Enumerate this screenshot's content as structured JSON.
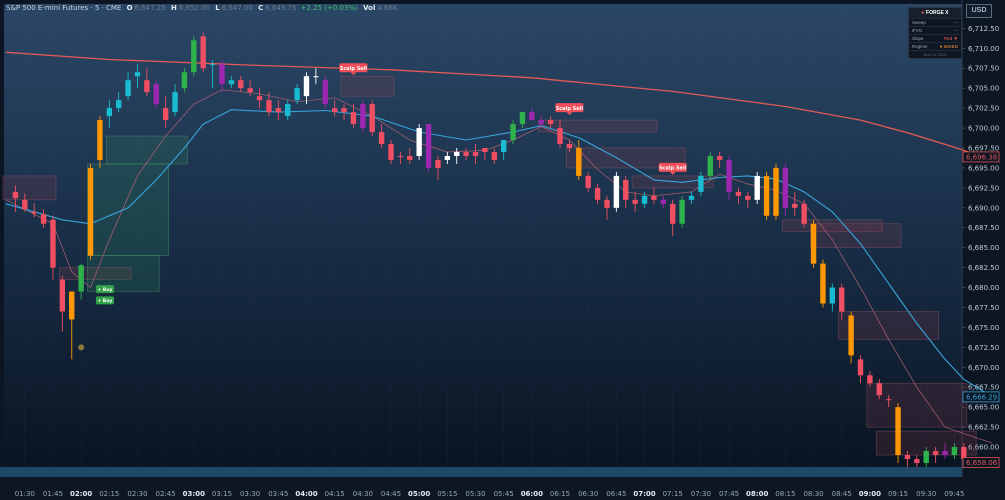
{
  "header": {
    "symbol": "S&P 500 E-mini Futures · 5 · CME",
    "o_label": "O",
    "o_value": "6,647.25",
    "h_label": "H",
    "h_value": "6,652.00",
    "l_label": "L",
    "l_value": "6,647.00",
    "c_label": "C",
    "c_value": "6,649.75",
    "change": "+2.25 (+0.03%)",
    "vol_label": "Vol",
    "vol_value": "4.66K"
  },
  "currency": "USD",
  "forge_panel": {
    "title": "FORGE X",
    "rows": [
      {
        "label": "Sweep",
        "value": "—"
      },
      {
        "label": "iFVG",
        "value": "—"
      },
      {
        "label": "Slope",
        "value": "Red ▼"
      },
      {
        "label": "Regime",
        "value": "● MIXED"
      }
    ],
    "footer": "Nov 12 2025"
  },
  "chart_data": {
    "type": "candlestick",
    "ylim": [
      6657.5,
      6713.8
    ],
    "y_ticks": [
      "6,712.50",
      "6,710.00",
      "6,707.50",
      "6,705.00",
      "6,702.50",
      "6,700.00",
      "6,697.50",
      "6,695.00",
      "6,692.50",
      "6,690.00",
      "6,687.50",
      "6,685.00",
      "6,682.50",
      "6,680.00",
      "6,677.50",
      "6,675.00",
      "6,672.50",
      "6,670.00",
      "6,667.50",
      "6,665.00",
      "6,662.50",
      "6,660.00"
    ],
    "x_ticks": [
      {
        "label": "01:30",
        "i": 1
      },
      {
        "label": "01:45",
        "i": 4
      },
      {
        "label": "02:00",
        "i": 7
      },
      {
        "label": "02:15",
        "i": 10
      },
      {
        "label": "02:30",
        "i": 13
      },
      {
        "label": "02:45",
        "i": 16
      },
      {
        "label": "03:00",
        "i": 19
      },
      {
        "label": "03:15",
        "i": 22
      },
      {
        "label": "03:30",
        "i": 25
      },
      {
        "label": "03:45",
        "i": 28
      },
      {
        "label": "04:00",
        "i": 31
      },
      {
        "label": "04:15",
        "i": 34
      },
      {
        "label": "04:30",
        "i": 37
      },
      {
        "label": "04:45",
        "i": 40
      },
      {
        "label": "05:00",
        "i": 43
      },
      {
        "label": "05:15",
        "i": 46
      },
      {
        "label": "05:30",
        "i": 49
      },
      {
        "label": "05:45",
        "i": 52
      },
      {
        "label": "06:00",
        "i": 55
      },
      {
        "label": "06:15",
        "i": 58
      },
      {
        "label": "06:30",
        "i": 61
      },
      {
        "label": "06:45",
        "i": 64
      },
      {
        "label": "07:00",
        "i": 67
      },
      {
        "label": "07:15",
        "i": 70
      },
      {
        "label": "07:30",
        "i": 73
      },
      {
        "label": "07:45",
        "i": 76
      },
      {
        "label": "08:00",
        "i": 79
      },
      {
        "label": "08:15",
        "i": 82
      },
      {
        "label": "08:30",
        "i": 85
      },
      {
        "label": "08:45",
        "i": 88
      },
      {
        "label": "09:00",
        "i": 91
      },
      {
        "label": "09:15",
        "i": 94
      },
      {
        "label": "09:30",
        "i": 97
      },
      {
        "label": "09:45",
        "i": 100
      }
    ],
    "bold_x_labels": [
      "02:00",
      "03:00",
      "04:00",
      "05:00",
      "06:00",
      "07:00",
      "08:00",
      "09:00"
    ],
    "price_labels": [
      {
        "value": "6,696.38",
        "price": 6696.38,
        "color": "#e05555"
      },
      {
        "value": "6,666.29",
        "price": 6666.29,
        "color": "#3aa0d8"
      },
      {
        "value": "6,658.06",
        "price": 6658.06,
        "color": "#e05555"
      }
    ],
    "candles": [
      [
        6692.0,
        6692.8,
        6689.5,
        6691.2,
        "r"
      ],
      [
        6691.0,
        6691.8,
        6689.5,
        6689.8,
        "r"
      ],
      [
        6689.5,
        6690.6,
        6688.8,
        6689.3,
        "r"
      ],
      [
        6689.2,
        6689.8,
        6687.5,
        6688.0,
        "r"
      ],
      [
        6688.5,
        6689.0,
        6681.0,
        6682.5,
        "r"
      ],
      [
        6681.0,
        6681.5,
        6674.5,
        6677.0,
        "r"
      ],
      [
        6676.0,
        6677.0,
        6671.0,
        6679.5,
        "o"
      ],
      [
        6679.5,
        6683.0,
        6678.5,
        6682.8,
        "g"
      ],
      [
        6684.0,
        6695.5,
        6683.5,
        6695.0,
        "o"
      ],
      [
        6696.0,
        6701.5,
        6695.0,
        6701.0,
        "o"
      ],
      [
        6701.5,
        6703.5,
        6700.0,
        6702.5,
        "c"
      ],
      [
        6702.5,
        6704.5,
        6702.0,
        6703.5,
        "c"
      ],
      [
        6704.0,
        6707.0,
        6703.5,
        6706.0,
        "c"
      ],
      [
        6706.5,
        6708.0,
        6705.0,
        6707.0,
        "c"
      ],
      [
        6706.0,
        6707.5,
        6704.0,
        6704.5,
        "r"
      ],
      [
        6705.5,
        6706.0,
        6702.5,
        6703.0,
        "p"
      ],
      [
        6702.5,
        6704.0,
        6700.0,
        6701.0,
        "r"
      ],
      [
        6702.0,
        6705.5,
        6701.5,
        6704.5,
        "c"
      ],
      [
        6705.0,
        6707.5,
        6704.5,
        6707.0,
        "g"
      ],
      [
        6707.0,
        6711.5,
        6706.5,
        6711.0,
        "g"
      ],
      [
        6711.5,
        6712.0,
        6707.0,
        6707.5,
        "r"
      ],
      [
        6708.0,
        6708.5,
        6705.0,
        6708.0,
        "c"
      ],
      [
        6708.0,
        6708.5,
        6704.5,
        6705.5,
        "p"
      ],
      [
        6706.0,
        6706.5,
        6705.0,
        6705.5,
        "c"
      ],
      [
        6706.0,
        6706.5,
        6704.5,
        6705.0,
        "r"
      ],
      [
        6705.0,
        6706.0,
        6704.0,
        6704.5,
        "r"
      ],
      [
        6704.0,
        6705.0,
        6702.5,
        6703.5,
        "r"
      ],
      [
        6703.5,
        6704.5,
        6701.5,
        6702.0,
        "r"
      ],
      [
        6702.0,
        6703.5,
        6701.0,
        6702.5,
        "r"
      ],
      [
        6701.5,
        6703.5,
        6701.0,
        6703.0,
        "c"
      ],
      [
        6703.5,
        6705.5,
        6703.0,
        6705.0,
        "c"
      ],
      [
        6704.0,
        6707.0,
        6703.0,
        6706.5,
        "w"
      ],
      [
        6706.5,
        6707.5,
        6705.5,
        6706.5,
        "w"
      ],
      [
        6706.0,
        6706.5,
        6702.5,
        6703.0,
        "p"
      ],
      [
        6702.5,
        6703.5,
        6701.5,
        6702.0,
        "r"
      ],
      [
        6702.0,
        6703.0,
        6701.0,
        6702.5,
        "r"
      ],
      [
        6702.0,
        6703.0,
        6700.0,
        6700.5,
        "r"
      ],
      [
        6700.0,
        6703.5,
        6699.5,
        6703.0,
        "p"
      ],
      [
        6703.0,
        6703.5,
        6699.0,
        6699.5,
        "r"
      ],
      [
        6699.5,
        6700.5,
        6697.5,
        6698.0,
        "r"
      ],
      [
        6698.0,
        6698.5,
        6695.5,
        6696.0,
        "r"
      ],
      [
        6696.5,
        6697.0,
        6695.5,
        6696.5,
        "r"
      ],
      [
        6696.0,
        6697.5,
        6695.5,
        6696.5,
        "r"
      ],
      [
        6696.5,
        6700.5,
        6696.0,
        6700.0,
        "w"
      ],
      [
        6700.5,
        6700.5,
        6694.5,
        6695.0,
        "p"
      ],
      [
        6695.0,
        6696.5,
        6693.5,
        6696.0,
        "r"
      ],
      [
        6696.0,
        6697.0,
        6695.5,
        6696.5,
        "w"
      ],
      [
        6696.5,
        6697.5,
        6695.5,
        6697.0,
        "w"
      ],
      [
        6697.0,
        6697.5,
        6696.0,
        6696.5,
        "r"
      ],
      [
        6696.5,
        6698.0,
        6695.5,
        6697.0,
        "r"
      ],
      [
        6697.0,
        6697.5,
        6696.0,
        6697.5,
        "r"
      ],
      [
        6696.0,
        6697.5,
        6695.5,
        6697.0,
        "r"
      ],
      [
        6697.0,
        6698.5,
        6696.0,
        6698.5,
        "c"
      ],
      [
        6698.5,
        6701.0,
        6698.0,
        6700.5,
        "g"
      ],
      [
        6700.5,
        6702.0,
        6700.0,
        6702.0,
        "g"
      ],
      [
        6702.0,
        6702.5,
        6701.0,
        6701.0,
        "p"
      ],
      [
        6701.0,
        6701.5,
        6700.0,
        6700.5,
        "p"
      ],
      [
        6701.0,
        6701.5,
        6700.0,
        6700.5,
        "r"
      ],
      [
        6700.0,
        6701.0,
        6697.5,
        6698.0,
        "r"
      ],
      [
        6698.0,
        6698.5,
        6697.0,
        6697.5,
        "r"
      ],
      [
        6697.5,
        6698.5,
        6693.5,
        6694.0,
        "o"
      ],
      [
        6694.0,
        6694.5,
        6692.0,
        6692.5,
        "r"
      ],
      [
        6692.5,
        6693.0,
        6690.5,
        6691.0,
        "r"
      ],
      [
        6691.0,
        6691.5,
        6688.5,
        6690.0,
        "r"
      ],
      [
        6690.0,
        6694.5,
        6689.5,
        6694.0,
        "w"
      ],
      [
        6693.5,
        6694.0,
        6690.0,
        6691.0,
        "r"
      ],
      [
        6691.0,
        6692.0,
        6689.5,
        6690.5,
        "r"
      ],
      [
        6690.5,
        6692.0,
        6690.0,
        6691.5,
        "c"
      ],
      [
        6691.5,
        6692.5,
        6690.5,
        6691.0,
        "r"
      ],
      [
        6691.0,
        6691.5,
        6690.0,
        6690.5,
        "p"
      ],
      [
        6690.5,
        6691.0,
        6686.5,
        6688.0,
        "r"
      ],
      [
        6688.0,
        6691.5,
        6687.5,
        6691.0,
        "g"
      ],
      [
        6691.0,
        6692.0,
        6690.5,
        6691.5,
        "c"
      ],
      [
        6692.0,
        6694.5,
        6691.5,
        6694.0,
        "c"
      ],
      [
        6694.0,
        6697.0,
        6693.5,
        6696.5,
        "g"
      ],
      [
        6696.5,
        6697.0,
        6695.0,
        6696.0,
        "r"
      ],
      [
        6696.0,
        6696.5,
        6691.0,
        6692.0,
        "p"
      ],
      [
        6692.0,
        6692.5,
        6690.5,
        6691.5,
        "r"
      ],
      [
        6691.5,
        6692.0,
        6690.0,
        6691.0,
        "r"
      ],
      [
        6691.0,
        6694.5,
        6690.5,
        6694.0,
        "w"
      ],
      [
        6694.0,
        6694.5,
        6688.5,
        6689.0,
        "o"
      ],
      [
        6689.0,
        6695.5,
        6688.5,
        6695.0,
        "o"
      ],
      [
        6695.0,
        6695.5,
        6689.0,
        6690.0,
        "p"
      ],
      [
        6690.0,
        6692.0,
        6689.0,
        6690.5,
        "r"
      ],
      [
        6690.5,
        6691.0,
        6687.5,
        6688.0,
        "r"
      ],
      [
        6688.0,
        6688.5,
        6682.5,
        6683.0,
        "o"
      ],
      [
        6683.0,
        6683.5,
        6677.5,
        6678.0,
        "o"
      ],
      [
        6678.0,
        6680.5,
        6677.0,
        6680.0,
        "c"
      ],
      [
        6680.0,
        6680.5,
        6676.0,
        6677.0,
        "r"
      ],
      [
        6676.5,
        6677.0,
        6670.5,
        6671.5,
        "o"
      ],
      [
        6671.0,
        6671.5,
        6668.0,
        6669.0,
        "r"
      ],
      [
        6669.0,
        6669.5,
        6667.5,
        6668.0,
        "r"
      ],
      [
        6668.0,
        6668.5,
        6666.0,
        6666.5,
        "r"
      ],
      [
        6666.0,
        6666.5,
        6665.0,
        6666.0,
        "r"
      ],
      [
        6665.0,
        6665.5,
        6658.0,
        6659.0,
        "o"
      ],
      [
        6659.0,
        6659.5,
        6657.5,
        6658.5,
        "r"
      ],
      [
        6658.5,
        6659.0,
        6657.5,
        6658.0,
        "r"
      ],
      [
        6658.0,
        6660.0,
        6657.5,
        6659.5,
        "g"
      ],
      [
        6659.0,
        6660.0,
        6658.0,
        6659.5,
        "r"
      ],
      [
        6659.5,
        6660.5,
        6658.5,
        6659.0,
        "p"
      ],
      [
        6659.0,
        6660.5,
        6658.5,
        6660.0,
        "g"
      ],
      [
        6660.0,
        6660.5,
        6658.0,
        6658.5,
        "r"
      ]
    ],
    "fvg_boxes": [
      {
        "i0": -1,
        "i1": 4,
        "top": 6694.0,
        "bottom": 6691.0,
        "kind": "bear"
      },
      {
        "i0": 5,
        "i1": 12,
        "top": 6682.5,
        "bottom": 6681.0,
        "kind": "bear"
      },
      {
        "i0": 8,
        "i1": 15,
        "top": 6684.0,
        "bottom": 6679.5,
        "kind": "bull"
      },
      {
        "i0": 8,
        "i1": 16,
        "top": 6695.5,
        "bottom": 6684.0,
        "kind": "bull"
      },
      {
        "i0": 10,
        "i1": 18,
        "top": 6699.0,
        "bottom": 6695.5,
        "kind": "bull"
      },
      {
        "i0": 35,
        "i1": 40,
        "top": 6706.5,
        "bottom": 6704.0,
        "kind": "bear"
      },
      {
        "i0": 56,
        "i1": 68,
        "top": 6701.0,
        "bottom": 6699.5,
        "kind": "bear"
      },
      {
        "i0": 59,
        "i1": 71,
        "top": 6697.5,
        "bottom": 6695.0,
        "kind": "bear"
      },
      {
        "i0": 66,
        "i1": 74,
        "top": 6694.0,
        "bottom": 6692.5,
        "kind": "bear"
      },
      {
        "i0": 82,
        "i1": 92,
        "top": 6688.5,
        "bottom": 6687.0,
        "kind": "bear"
      },
      {
        "i0": 85,
        "i1": 94,
        "top": 6688.0,
        "bottom": 6685.0,
        "kind": "bear"
      },
      {
        "i0": 88,
        "i1": 98,
        "top": 6677.0,
        "bottom": 6673.5,
        "kind": "bear"
      },
      {
        "i0": 91,
        "i1": 101,
        "top": 6668.0,
        "bottom": 6662.5,
        "kind": "bear"
      },
      {
        "i0": 92,
        "i1": 102,
        "top": 6662.0,
        "bottom": 6659.0,
        "kind": "bear"
      }
    ],
    "signals": [
      {
        "label": "Scalp Sell",
        "i": 36,
        "price": 6707.5,
        "kind": "sell"
      },
      {
        "label": "Scalp Sell",
        "i": 59,
        "price": 6702.5,
        "kind": "sell"
      },
      {
        "label": "Scalp Sell",
        "i": 70,
        "price": 6695.0,
        "kind": "sell"
      },
      {
        "label": "+ Buy",
        "i": 9,
        "price": 6679.8,
        "kind": "buy"
      },
      {
        "label": "+ Buy",
        "i": 9,
        "price": 6678.4,
        "kind": "buy"
      }
    ],
    "ma_slow": {
      "name": "",
      "color": "#e35a55",
      "points": [
        [
          -1,
          6709.5
        ],
        [
          10,
          6708.6
        ],
        [
          25,
          6707.9
        ],
        [
          40,
          6707.3
        ],
        [
          55,
          6706.3
        ],
        [
          70,
          6704.6
        ],
        [
          82,
          6702.7
        ],
        [
          90,
          6701.0
        ],
        [
          95,
          6699.4
        ],
        [
          100,
          6697.6
        ],
        [
          104,
          6696.0
        ]
      ]
    },
    "ma_fast": {
      "name": "",
      "color": "#38a4da",
      "points": [
        [
          -1,
          6690.5
        ],
        [
          5,
          6688.5
        ],
        [
          8,
          6688.0
        ],
        [
          12,
          6690.0
        ],
        [
          15,
          6693.5
        ],
        [
          18,
          6697.5
        ],
        [
          20,
          6700.5
        ],
        [
          23,
          6702.3
        ],
        [
          28,
          6702.0
        ],
        [
          33,
          6702.2
        ],
        [
          38,
          6701.5
        ],
        [
          43,
          6699.5
        ],
        [
          48,
          6698.5
        ],
        [
          53,
          6699.5
        ],
        [
          56,
          6700.3
        ],
        [
          60,
          6698.8
        ],
        [
          64,
          6696.3
        ],
        [
          68,
          6693.5
        ],
        [
          71,
          6693.2
        ],
        [
          75,
          6693.8
        ],
        [
          78,
          6694.0
        ],
        [
          81,
          6693.6
        ],
        [
          84,
          6692.0
        ],
        [
          87,
          6689.5
        ],
        [
          90,
          6685.5
        ],
        [
          93,
          6680.5
        ],
        [
          96,
          6675.5
        ],
        [
          99,
          6671.0
        ],
        [
          101,
          6668.5
        ],
        [
          104,
          6666.3
        ]
      ]
    },
    "ma_mid": {
      "name": "",
      "color": "#b06070",
      "points": [
        [
          -1,
          6691.0
        ],
        [
          4,
          6688.0
        ],
        [
          6,
          6682.0
        ],
        [
          8,
          6680.0
        ],
        [
          10,
          6686.0
        ],
        [
          13,
          6694.0
        ],
        [
          16,
          6699.0
        ],
        [
          19,
          6703.0
        ],
        [
          22,
          6704.8
        ],
        [
          26,
          6704.3
        ],
        [
          30,
          6703.3
        ],
        [
          34,
          6703.8
        ],
        [
          38,
          6701.5
        ],
        [
          42,
          6698.5
        ],
        [
          46,
          6697.0
        ],
        [
          50,
          6697.2
        ],
        [
          53,
          6698.5
        ],
        [
          56,
          6700.2
        ],
        [
          59,
          6698.5
        ],
        [
          62,
          6694.8
        ],
        [
          65,
          6692.0
        ],
        [
          68,
          6691.5
        ],
        [
          72,
          6692.0
        ],
        [
          75,
          6694.2
        ],
        [
          78,
          6693.0
        ],
        [
          81,
          6692.2
        ],
        [
          84,
          6690.5
        ],
        [
          87,
          6686.0
        ],
        [
          90,
          6680.0
        ],
        [
          93,
          6673.5
        ],
        [
          96,
          6667.5
        ],
        [
          99,
          6662.5
        ],
        [
          104,
          6660.5
        ]
      ]
    }
  }
}
